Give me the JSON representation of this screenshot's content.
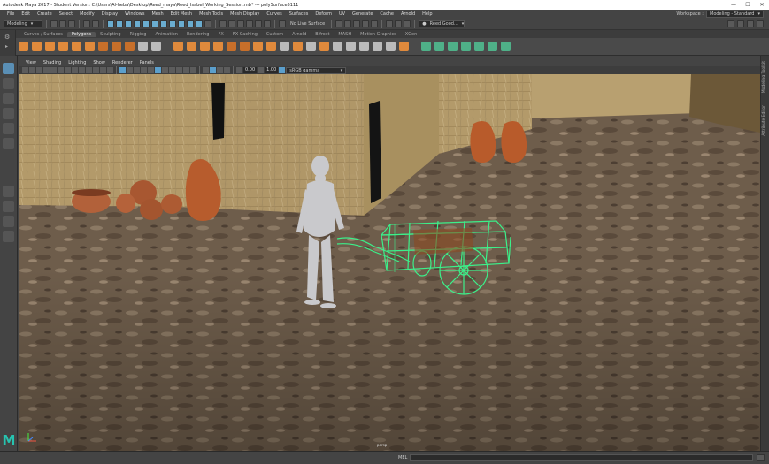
{
  "window": {
    "title": "Autodesk Maya 2017 - Student Version: C:\\Users\\Al-heba\\Desktop\\Reed_maya\\Reed_Isabel_Working_Session.mb*  ---  polySurface5111",
    "minimize": "—",
    "maximize": "☐",
    "close": "✕"
  },
  "menubar": {
    "items": [
      "File",
      "Edit",
      "Create",
      "Select",
      "Modify",
      "Display",
      "Windows",
      "Mesh",
      "Edit Mesh",
      "Mesh Tools",
      "Mesh Display",
      "Curves",
      "Surfaces",
      "Deform",
      "UV",
      "Generate",
      "Cache",
      "Arnold",
      "Help"
    ],
    "workspace_label": "Workspace :",
    "workspace_value": "Modeling - Standard"
  },
  "statusline": {
    "mode": "Modeling",
    "live_surface": "No Live Surface",
    "user": "Reed Good..."
  },
  "shelf": {
    "tabs": [
      "Curves / Surfaces",
      "Polygons",
      "Sculpting",
      "Rigging",
      "Animation",
      "Rendering",
      "FX",
      "FX Caching",
      "Custom",
      "Arnold",
      "Bifrost",
      "MASH",
      "Motion Graphics",
      "XGen"
    ],
    "active_tab": "Polygons"
  },
  "panel": {
    "menus": [
      "View",
      "Shading",
      "Lighting",
      "Show",
      "Renderer",
      "Panels"
    ],
    "near_clip": "0.00",
    "far_clip": "1.00",
    "colorspace": "sRGB gamma"
  },
  "viewport": {
    "camera_label": "persp"
  },
  "rightbar": {
    "tabs": [
      "Modeling Toolkit",
      "Attribute Editor"
    ]
  },
  "helpline": {
    "mel_label": "MEL"
  },
  "colors": {
    "accent": "#5a8fb5",
    "wireframe": "#3cf08a",
    "logo": "#27c3b0"
  }
}
